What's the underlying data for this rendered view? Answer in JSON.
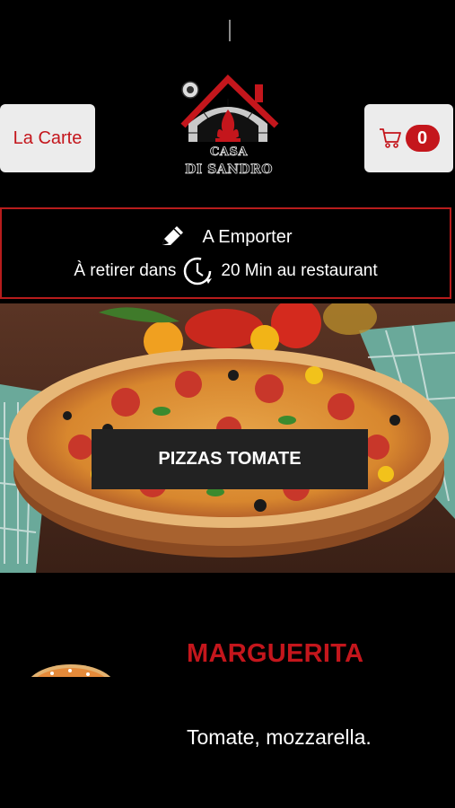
{
  "header": {
    "menu_button_label": "La Carte",
    "cart_count": "0",
    "logo": {
      "line1": "CASA",
      "line2": "DI SANDRO"
    }
  },
  "order_info": {
    "mode_label": "A Emporter",
    "pickup_prefix": "À retirer dans",
    "pickup_suffix": "20 Min au restaurant"
  },
  "category": {
    "title": "PIZZAS TOMATE"
  },
  "product": {
    "name": "MARGUERITA",
    "description": "Tomate, mozzarella."
  },
  "colors": {
    "accent": "#c4161c",
    "background": "#000000",
    "button_bg": "#ececec"
  }
}
